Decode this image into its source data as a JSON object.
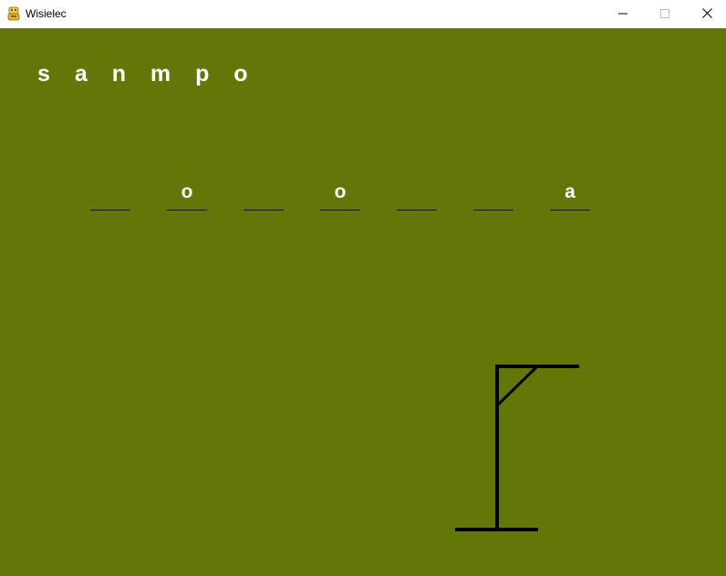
{
  "window": {
    "title": "Wisielec",
    "app_icon": "python-icon",
    "controls": {
      "minimize_icon": "minimize-icon",
      "maximize_icon": "maximize-icon",
      "close_icon": "close-icon"
    }
  },
  "game": {
    "background_color": "#637709",
    "used_letters": "s a n m p o",
    "word_slots": [
      "",
      "o",
      "",
      "o",
      "",
      "",
      "a"
    ],
    "hangman_stage": "gallows",
    "drawing_color": "#000000"
  }
}
